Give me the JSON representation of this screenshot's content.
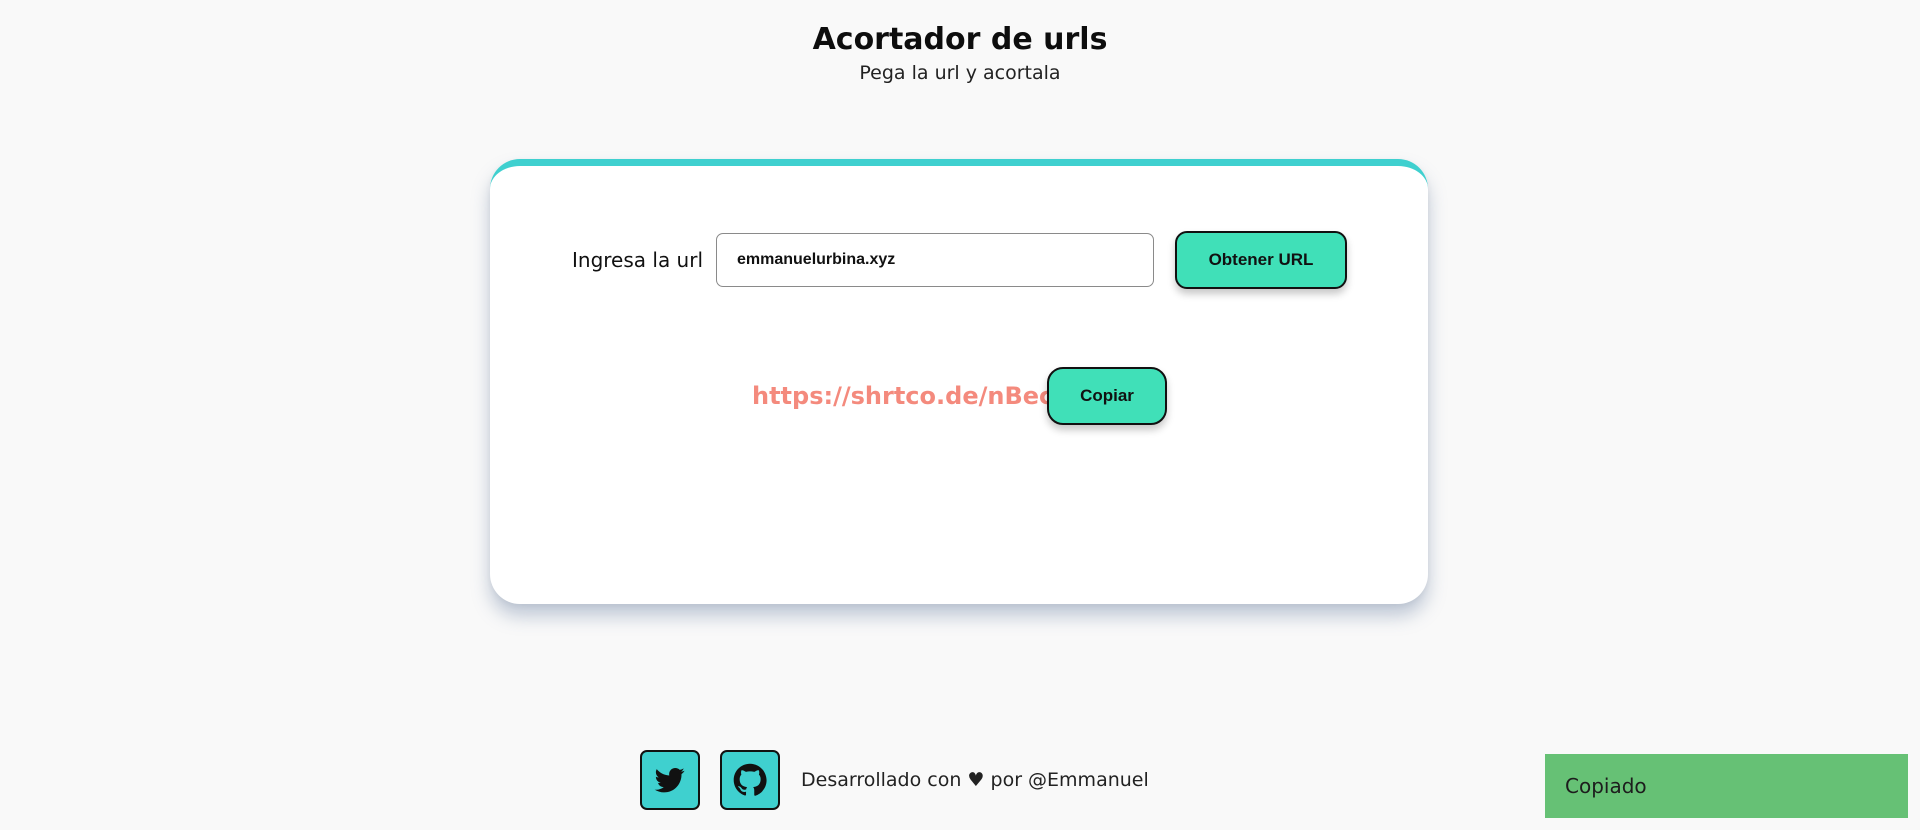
{
  "header": {
    "title": "Acortador de urls",
    "subtitle": "Pega la url y acortala"
  },
  "form": {
    "label": "Ingresa la url",
    "input_value": "emmanuelurbina.xyz",
    "submit_label": "Obtener URL"
  },
  "result": {
    "short_url": "https://shrtco.de/nBec5w",
    "copy_label": "Copiar"
  },
  "footer": {
    "text": "Desarrollado con ♥ por @Emmanuel",
    "icons": [
      "twitter-icon",
      "github-icon"
    ]
  },
  "toast": {
    "message": "Copiado"
  },
  "colors": {
    "accent": "#3fd0cf",
    "button": "#40e0b8",
    "link": "#f48a7d",
    "toast": "#66c175",
    "background": "#f9f9f9"
  }
}
